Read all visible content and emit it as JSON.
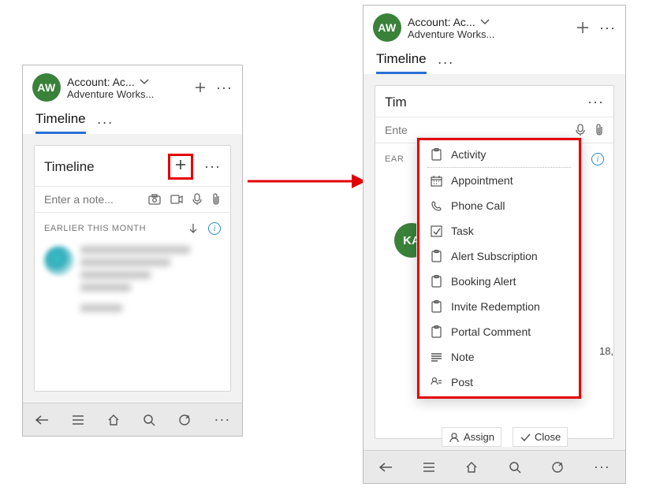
{
  "header": {
    "avatar_initials": "AW",
    "title": "Account: Ac...",
    "subtitle": "Adventure Works..."
  },
  "tabs": {
    "active": "Timeline"
  },
  "card": {
    "title": "Timeline",
    "note_placeholder": "Enter a note...",
    "section": "EARLIER THIS MONTH"
  },
  "dropdown": [
    {
      "icon": "clipboard",
      "label": "Activity"
    },
    {
      "icon": "calendar",
      "label": "Appointment"
    },
    {
      "icon": "phone",
      "label": "Phone Call"
    },
    {
      "icon": "check",
      "label": "Task"
    },
    {
      "icon": "clipboard",
      "label": "Alert Subscription"
    },
    {
      "icon": "clipboard",
      "label": "Booking Alert"
    },
    {
      "icon": "clipboard",
      "label": "Invite Redemption"
    },
    {
      "icon": "clipboard",
      "label": "Portal Comment"
    },
    {
      "icon": "note",
      "label": "Note"
    },
    {
      "icon": "post",
      "label": "Post"
    }
  ],
  "right_partial": {
    "avatar_initials": "KA",
    "date_fragment": "18,"
  },
  "quick_actions": {
    "assign": "Assign",
    "close": "Close"
  },
  "card_partial": {
    "title_fragment": "Tim",
    "note_fragment": "Ente",
    "section_fragment": "EAR"
  }
}
